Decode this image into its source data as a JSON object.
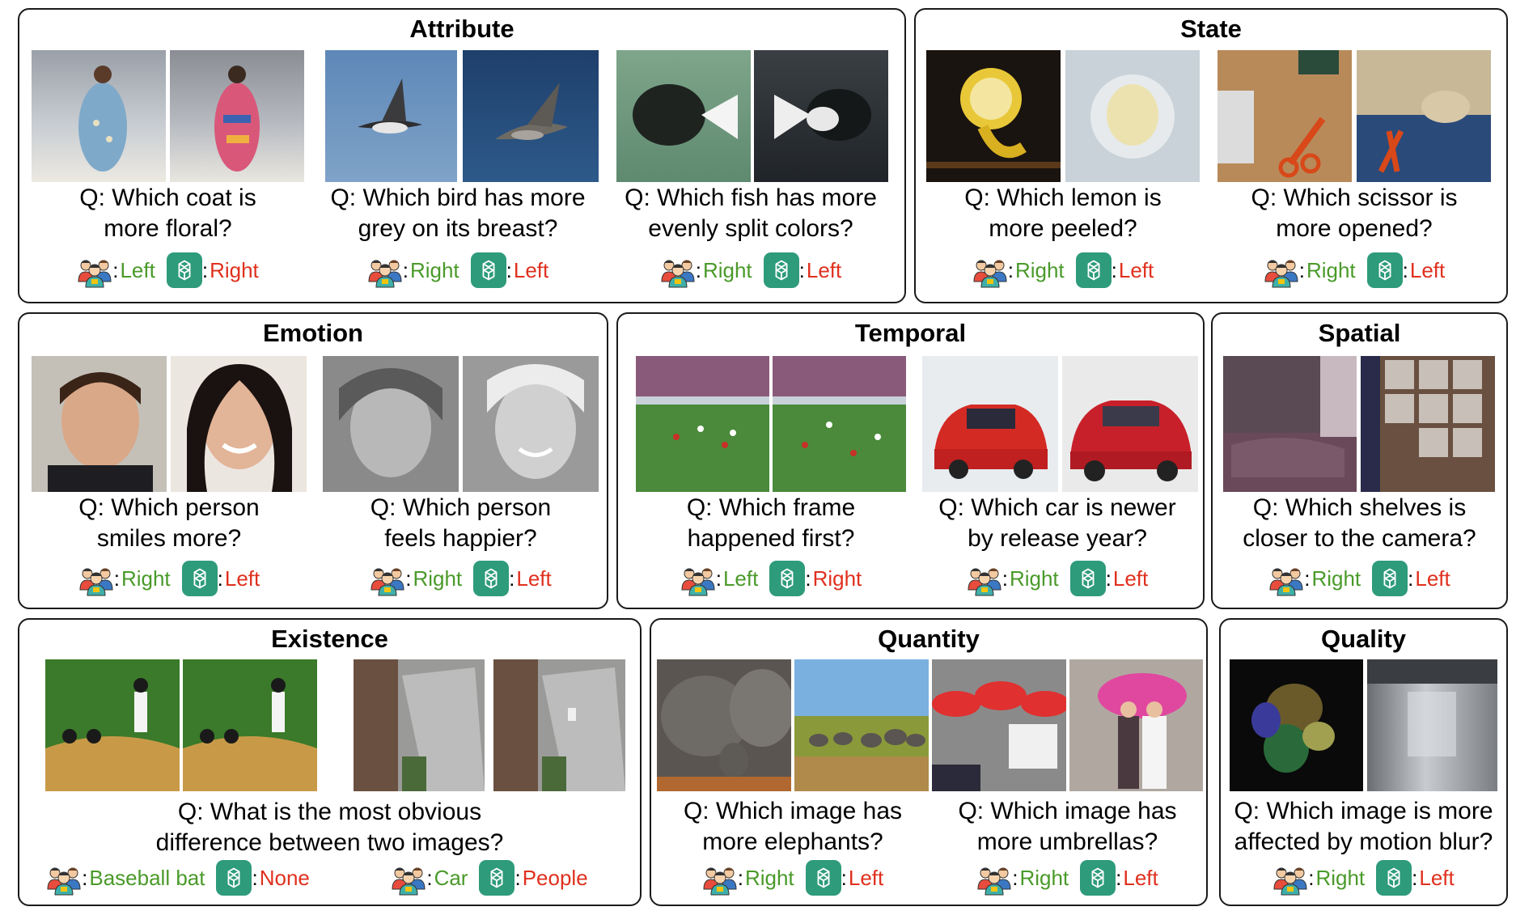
{
  "colors": {
    "human_answer": "#4a9a2a",
    "model_answer": "#e0301e",
    "gpt_icon_bg": "#2e9b7a",
    "panel_border": "#1a1a1a"
  },
  "icons": {
    "human": "people-group-icon",
    "model": "chatgpt-logo-icon"
  },
  "panels": {
    "attribute": {
      "title": "Attribute",
      "items": [
        {
          "q1": "Q: Which coat is",
          "q2": "more floral?",
          "human": "Left",
          "model": "Right"
        },
        {
          "q1": "Q: Which bird has more",
          "q2": "grey on its breast?",
          "human": "Right",
          "model": "Left"
        },
        {
          "q1": "Q: Which fish has more",
          "q2": "evenly split colors?",
          "human": "Right",
          "model": "Left"
        }
      ]
    },
    "state": {
      "title": "State",
      "items": [
        {
          "q1": "Q: Which lemon is",
          "q2": "more peeled?",
          "human": "Right",
          "model": "Left"
        },
        {
          "q1": "Q: Which scissor is",
          "q2": "more opened?",
          "human": "Right",
          "model": "Left"
        }
      ]
    },
    "emotion": {
      "title": "Emotion",
      "items": [
        {
          "q1": "Q: Which person",
          "q2": "smiles more?",
          "human": "Right",
          "model": "Left"
        },
        {
          "q1": "Q: Which person",
          "q2": "feels happier?",
          "human": "Right",
          "model": "Left"
        }
      ]
    },
    "temporal": {
      "title": "Temporal",
      "items": [
        {
          "q1": "Q: Which frame",
          "q2": "happened first?",
          "human": "Left",
          "model": "Right"
        },
        {
          "q1": "Q: Which car is newer",
          "q2": "by release year?",
          "human": "Right",
          "model": "Left"
        }
      ]
    },
    "spatial": {
      "title": "Spatial",
      "items": [
        {
          "q1": "Q: Which shelves is",
          "q2": "closer to the camera?",
          "human": "Right",
          "model": "Left"
        }
      ]
    },
    "existence": {
      "title": "Existence",
      "question_1": "Q: What is the most obvious",
      "question_2": "difference between two images?",
      "items": [
        {
          "human": "Baseball bat",
          "model": "None"
        },
        {
          "human": "Car",
          "model": "People"
        }
      ]
    },
    "quantity": {
      "title": "Quantity",
      "items": [
        {
          "q1": "Q: Which image has",
          "q2": "more elephants?",
          "human": "Right",
          "model": "Left"
        },
        {
          "q1": "Q: Which image has",
          "q2": "more umbrellas?",
          "human": "Right",
          "model": "Left"
        }
      ]
    },
    "quality": {
      "title": "Quality",
      "items": [
        {
          "q1": "Q: Which image is more",
          "q2": "affected by motion blur?",
          "human": "Right",
          "model": "Left"
        }
      ]
    }
  }
}
